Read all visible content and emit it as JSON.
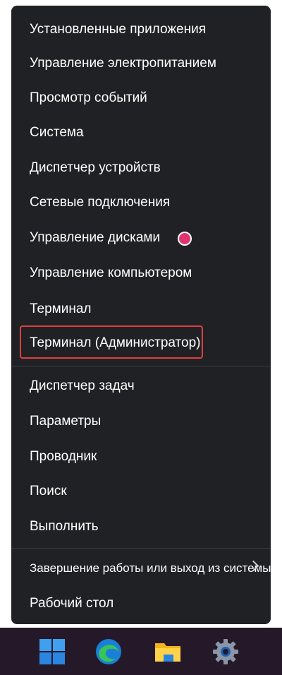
{
  "menu": {
    "items": [
      {
        "label": "Установленные приложения"
      },
      {
        "label": "Управление электропитанием"
      },
      {
        "label": "Просмотр событий"
      },
      {
        "label": "Система"
      },
      {
        "label": "Диспетчер устройств"
      },
      {
        "label": "Сетевые подключения"
      },
      {
        "label": "Управление дисками"
      },
      {
        "label": "Управление компьютером"
      },
      {
        "label": "Терминал"
      },
      {
        "label": "Терминал (Администратор)",
        "highlighted": true
      },
      {
        "label": "Диспетчер задач"
      },
      {
        "label": "Параметры"
      },
      {
        "label": "Проводник"
      },
      {
        "label": "Поиск"
      },
      {
        "label": "Выполнить"
      },
      {
        "label": "Завершение работы или выход из системы",
        "has_submenu": true
      },
      {
        "label": "Рабочий стол"
      }
    ]
  },
  "taskbar": {
    "icons": [
      "windows-start-icon",
      "edge-browser-icon",
      "file-explorer-icon",
      "settings-gear-icon"
    ]
  },
  "colors": {
    "menu_bg": "#202124",
    "highlight_border": "#e04040",
    "marker_dot": "#e03470",
    "taskbar_bg": "#251929"
  }
}
